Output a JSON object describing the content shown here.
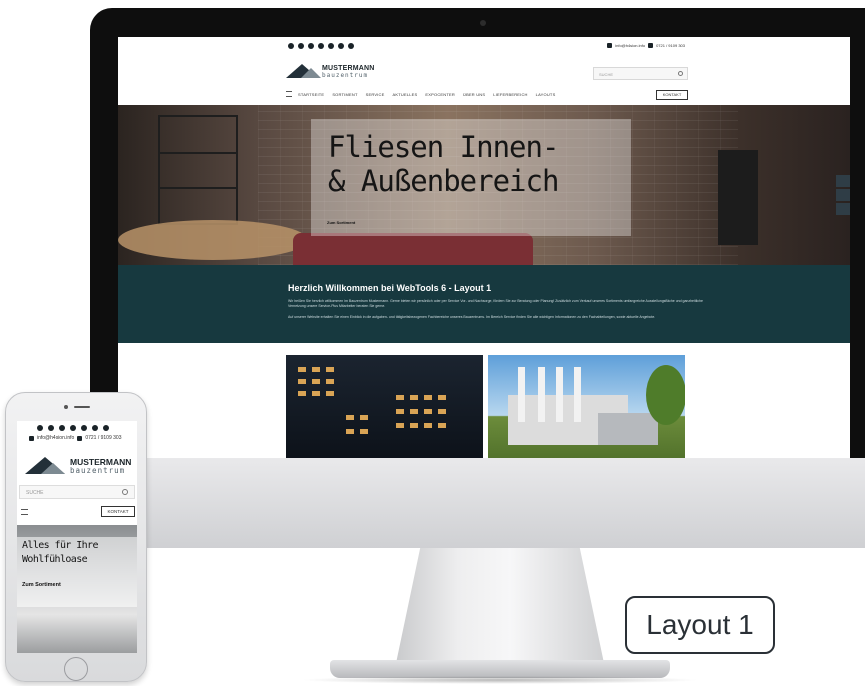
{
  "desktop": {
    "topbar": {
      "social_icons": [
        "facebook-icon",
        "twitter-icon",
        "instagram-icon",
        "pinterest-icon",
        "flickr-icon",
        "youtube-icon",
        "xing-icon"
      ],
      "email": "info@h4sion.info",
      "phone": "0721 / 9109 303"
    },
    "header": {
      "logo_name": "MUSTERMANN",
      "logo_sub": "bauzentrum",
      "search_placeholder": "SUCHE"
    },
    "nav": {
      "items": [
        "STARTSEITE",
        "SORTIMENT",
        "SERVICE",
        "AKTUELLES",
        "EXPOCENTER",
        "ÜBER UNS",
        "LIEFERBEREICH",
        "LAYOUTS"
      ],
      "cta": "KONTAKT"
    },
    "hero": {
      "title": "Fliesen Innen-\n& Außenbereich",
      "title_line1": "Fliesen Innen-",
      "title_line2": "& Außenbereich",
      "button": "Zum Sortiment"
    },
    "welcome": {
      "heading": "Herzlich Willkommen bei WebTools 6 - Layout 1",
      "paragraph1": "Wir heißen Sie herzlich willkommen im Bauzentrum Mustermann. Gerne bieten wir persönlich oder per Service Vor- und Nachsorge, fördern Sie zur Beratung oder Planung! Zusätzlich zum Verkauf unseres Sortiments umfangreiche Ausstellungsfläche und ganzheitliche Vernetzung unsere Service-Plus Mitarbeiter beraten Sie gerne.",
      "paragraph2": "Auf unserer Website erhalten Sie einen Einblick in die aufgaben- und tätigkeitsbezogenen Fachbereiche unseres Bauzentrums. Im Bereich Service finden Sie alle wichtigen Informationen zu den Fachabteilungen, sowie aktuelle Angebote."
    }
  },
  "phone": {
    "social_icons": [
      "facebook-icon",
      "twitter-icon",
      "instagram-icon",
      "pinterest-icon",
      "flickr-icon",
      "youtube-icon",
      "xing-icon"
    ],
    "email": "info@h4sion.info",
    "phone": "0721 / 9109 303",
    "logo_name": "MUSTERMANN",
    "logo_sub": "bauzentrum",
    "search_placeholder": "SUCHE",
    "cta": "KONTAKT",
    "hero_title_line1": "Alles für Ihre",
    "hero_title_line2": "Wohlfühloase",
    "hero_button": "Zum Sortiment"
  },
  "label": "Layout 1",
  "colors": {
    "brand_dark": "#1a2328",
    "welcome_bg": "#17393f",
    "label_border": "#2a3036"
  }
}
